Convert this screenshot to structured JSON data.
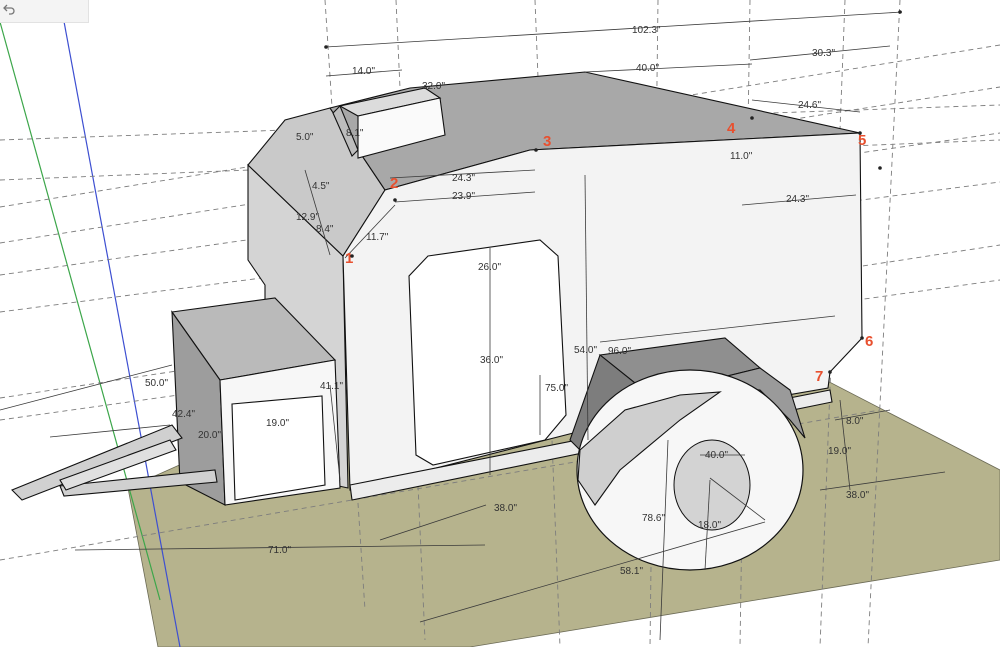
{
  "toolbar": {
    "undo_icon": "undo-arrow-icon"
  },
  "colors": {
    "ground": "#b6b38d",
    "face_light": "#ffffff",
    "face_mid": "#d9d9d9",
    "face_dark": "#a4a4a4",
    "axis_green": "#3ca64a",
    "axis_blue": "#3d4fd1",
    "point_label": "#e8502f"
  },
  "point_labels": [
    "1",
    "2",
    "3",
    "4",
    "5",
    "6",
    "7"
  ],
  "dimensions": {
    "d_102_3": "102.3\"",
    "d_30_3": "30.3\"",
    "d_40_0_top": "40.0\"",
    "d_14_0": "14.0\"",
    "d_32_0": "32.0\"",
    "d_24_6": "24.6\"",
    "d_5_0": "5.0\"",
    "d_8_1": "8.1\"",
    "d_4_5": "4.5\"",
    "d_12_9": "12.9\"",
    "d_8_4": "8.4\"",
    "d_11_7": "11.7\"",
    "d_24_3_a": "24.3\"",
    "d_23_9": "23.9\"",
    "d_11_0": "11.0\"",
    "d_24_3_b": "24.3\"",
    "d_26_0": "26.0\"",
    "d_36_0": "36.0\"",
    "d_54_0": "54.0\"",
    "d_96_0": "96.0\"",
    "d_75_0": "75.0\"",
    "d_50_0": "50.0\"",
    "d_42_4": "42.4\"",
    "d_41_1": "41.1\"",
    "d_20_0": "20.0\"",
    "d_19_0_box": "19.0\"",
    "d_40_0_wheel": "40.0\"",
    "d_18_0": "18.0\"",
    "d_78_6": "78.6\"",
    "d_58_1": "58.1\"",
    "d_38_0_a": "38.0\"",
    "d_71_0": "71.0\"",
    "d_8_0": "8.0\"",
    "d_19_0_right": "19.0\"",
    "d_38_0_b": "38.0\""
  }
}
